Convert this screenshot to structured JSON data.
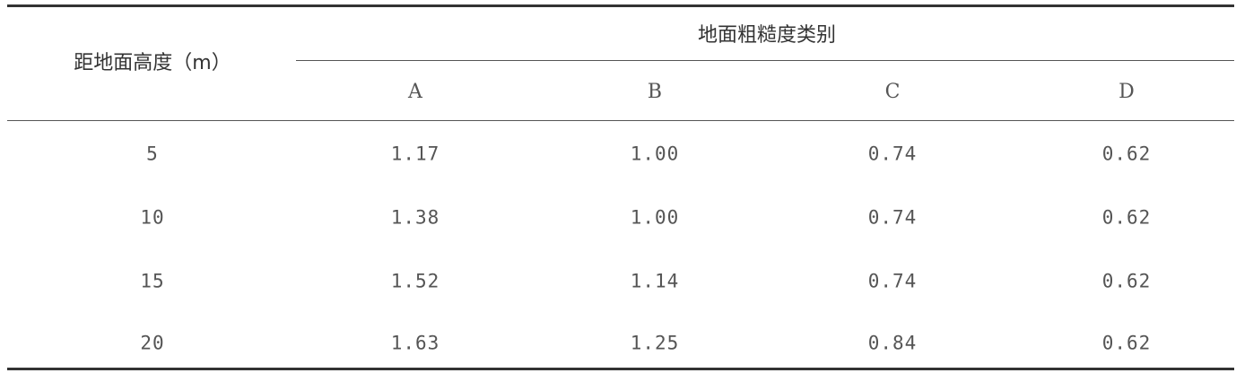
{
  "table": {
    "row_header": "距地面高度（m）",
    "group_header": "地面粗糙度类别",
    "columns": [
      "A",
      "B",
      "C",
      "D"
    ],
    "rows": [
      {
        "height": "5",
        "values": [
          "1.17",
          "1.00",
          "0.74",
          "0.62"
        ]
      },
      {
        "height": "10",
        "values": [
          "1.38",
          "1.00",
          "0.74",
          "0.62"
        ]
      },
      {
        "height": "15",
        "values": [
          "1.52",
          "1.14",
          "0.74",
          "0.62"
        ]
      },
      {
        "height": "20",
        "values": [
          "1.63",
          "1.25",
          "0.84",
          "0.62"
        ]
      }
    ]
  }
}
